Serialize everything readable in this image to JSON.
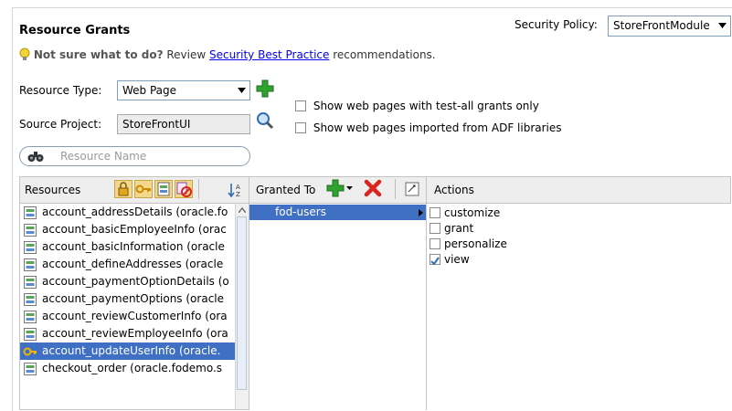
{
  "title": "Resource Grants",
  "hint": {
    "prefix": "Not sure what to do?",
    "review": " Review ",
    "link": "Security Best Practice",
    "suffix": " recommendations."
  },
  "security_policy": {
    "label": "Security Policy:",
    "value": "StoreFrontModule"
  },
  "resource_type": {
    "label": "Resource Type:",
    "value": "Web Page"
  },
  "source_project": {
    "label": "Source Project:",
    "value": "StoreFrontUI"
  },
  "options": [
    {
      "label": "Show web pages with test-all grants only",
      "checked": false
    },
    {
      "label": "Show web pages imported from ADF libraries",
      "checked": false
    }
  ],
  "search": {
    "placeholder": "Resource Name"
  },
  "resources": {
    "header": "Resources",
    "items": [
      {
        "label": "account_addressDetails (oracle.fo",
        "selected": false,
        "icon": "page-icon"
      },
      {
        "label": "account_basicEmployeeInfo (orac",
        "selected": false,
        "icon": "page-icon"
      },
      {
        "label": "account_basicInformation (oracle",
        "selected": false,
        "icon": "page-icon"
      },
      {
        "label": "account_defineAddresses (oracle",
        "selected": false,
        "icon": "page-icon"
      },
      {
        "label": "account_paymentOptionDetails (o",
        "selected": false,
        "icon": "page-icon"
      },
      {
        "label": "account_paymentOptions (oracle",
        "selected": false,
        "icon": "page-icon"
      },
      {
        "label": "account_reviewCustomerInfo (ora",
        "selected": false,
        "icon": "page-icon"
      },
      {
        "label": "account_reviewEmployeeInfo (ora",
        "selected": false,
        "icon": "page-icon"
      },
      {
        "label": "account_updateUserInfo (oracle.",
        "selected": true,
        "icon": "key-icon"
      },
      {
        "label": "checkout_order (oracle.fodemo.s",
        "selected": false,
        "icon": "page-icon"
      }
    ]
  },
  "granted_to": {
    "header": "Granted To",
    "items": [
      {
        "label": "fod-users",
        "selected": true
      }
    ]
  },
  "actions": {
    "header": "Actions",
    "items": [
      {
        "label": "customize",
        "checked": false
      },
      {
        "label": "grant",
        "checked": false
      },
      {
        "label": "personalize",
        "checked": false
      },
      {
        "label": "view",
        "checked": true
      }
    ]
  },
  "colors": {
    "selection": "#3f70c4",
    "link": "#0000ee",
    "add_green": "#2fa32f",
    "delete_red": "#d8261e"
  }
}
